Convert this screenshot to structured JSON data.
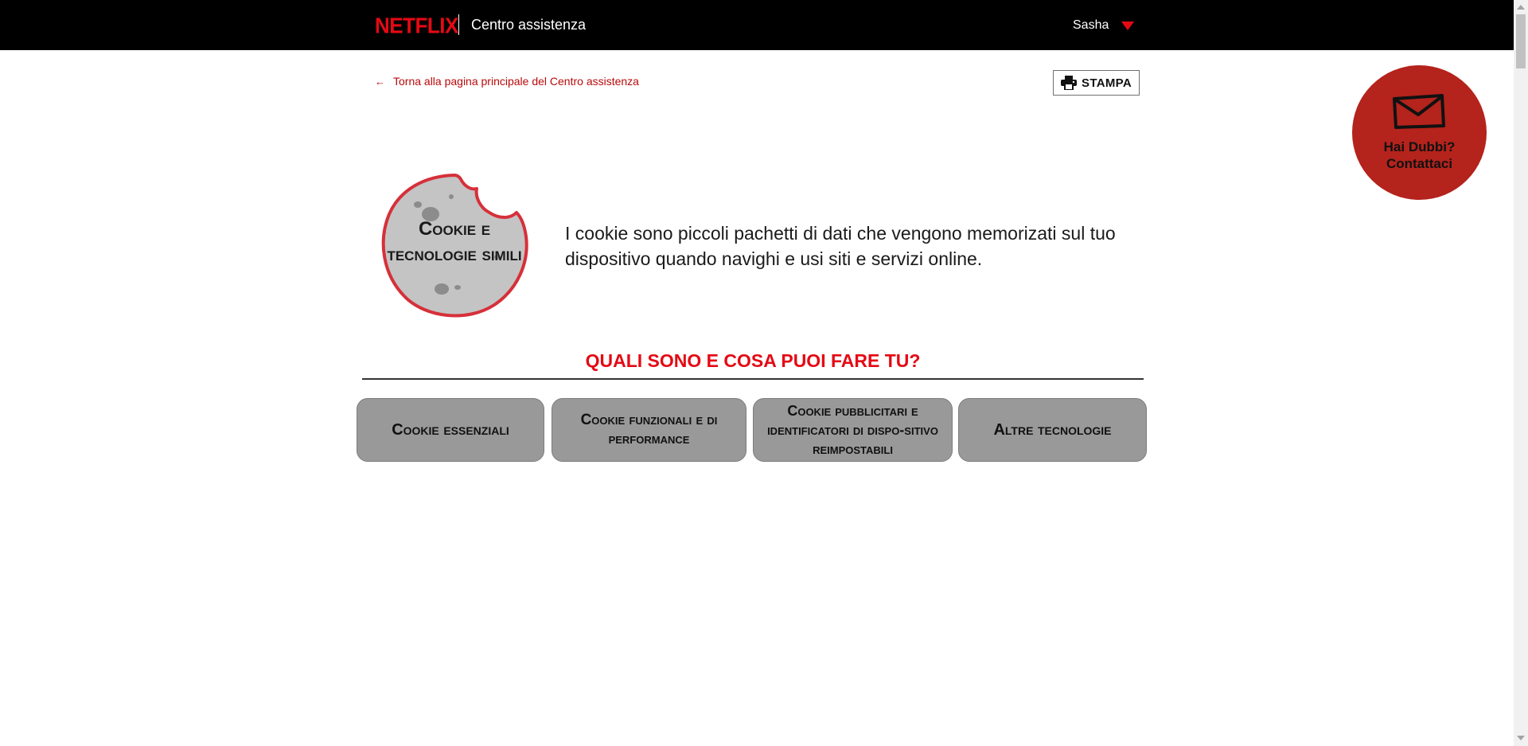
{
  "header": {
    "logo_text": "NETFLIX",
    "title": "Centro assistenza",
    "user_name": "Sasha",
    "user_menu_icon": "caret-down-icon"
  },
  "nav": {
    "back_link": "Torna alla pagina principale del Centro assistenza",
    "back_icon": "arrow-left-icon",
    "print_label": "STAMPA",
    "print_icon": "printer-icon"
  },
  "contact": {
    "label": "Hai Dubbi?\nContattaci",
    "icon": "mail-icon",
    "color": "#b4231c"
  },
  "hero": {
    "badge_title": "Cookie e tecnologie simili",
    "intro": "I cookie sono piccoli pachetti di dati che vengono memorizati sul tuo dispositivo quando navighi e usi siti e servizi online."
  },
  "section": {
    "heading": "QUALI SONO E COSA PUOI FARE TU?"
  },
  "categories": [
    {
      "label": "Cookie essenziali"
    },
    {
      "label": "Cookie funzionali e di performance"
    },
    {
      "label": "Cookie pubblicitari  e identificatori di dispo-sitivo reimpostabili"
    },
    {
      "label": "Altre tecnologie"
    }
  ],
  "colors": {
    "brand_red": "#e50914",
    "link_red": "#b9090b",
    "button_gray": "#999999"
  }
}
